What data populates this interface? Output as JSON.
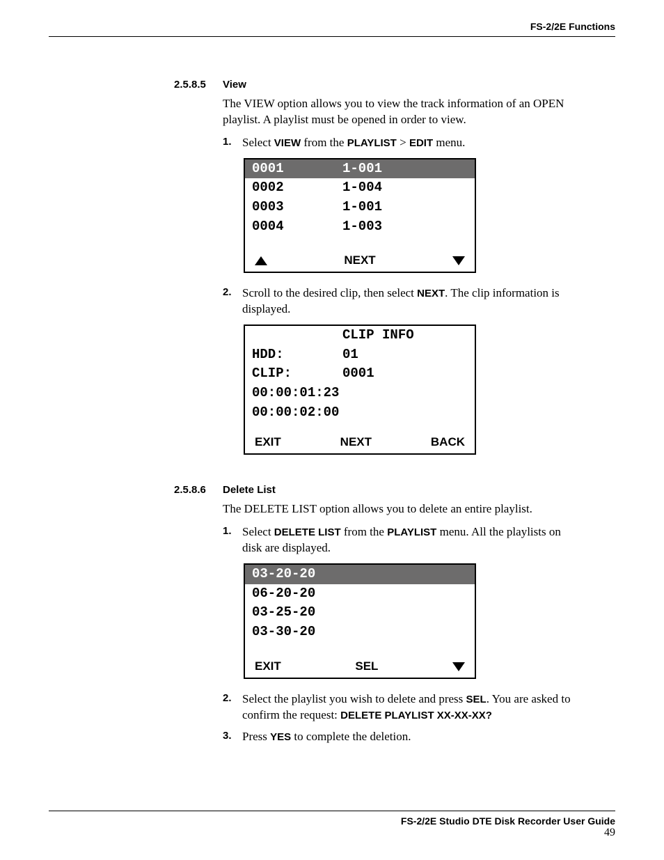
{
  "header": {
    "title": "FS-2/2E Functions"
  },
  "sectionA": {
    "num": "2.5.8.5",
    "title": "View",
    "intro": "The VIEW option allows you to view the track information of an OPEN playlist. A playlist must be opened in order to view.",
    "step1_num": "1.",
    "step1_pre": "Select ",
    "step1_b1": "VIEW",
    "step1_mid": " from the ",
    "step1_b2": "PLAYLIST",
    "step1_gt": " > ",
    "step1_b3": "EDIT",
    "step1_post": " menu.",
    "screen1": {
      "rows": [
        {
          "c1": "0001",
          "c2": "1-001",
          "hl": true
        },
        {
          "c1": "0002",
          "c2": "1-004"
        },
        {
          "c1": "0003",
          "c2": "1-001"
        },
        {
          "c1": "0004",
          "c2": "1-003"
        }
      ],
      "footer_center": "NEXT"
    },
    "step2_num": "2.",
    "step2_pre": "Scroll to the desired clip, then select ",
    "step2_b1": "NEXT",
    "step2_post": ". The clip information is displayed.",
    "screen2": {
      "title": "CLIP INFO",
      "row1_label": "HDD:",
      "row1_val": "01",
      "row2_label": "CLIP:",
      "row2_val": "0001",
      "row3": "00:00:01:23",
      "row4": "00:00:02:00",
      "footer_left": "EXIT",
      "footer_center": "NEXT",
      "footer_right": "BACK"
    }
  },
  "sectionB": {
    "num": "2.5.8.6",
    "title": "Delete List",
    "intro": "The DELETE LIST option allows you to delete an entire playlist.",
    "step1_num": "1.",
    "step1_pre": "Select ",
    "step1_b1": "DELETE LIST",
    "step1_mid": " from the ",
    "step1_b2": "PLAYLIST",
    "step1_post": " menu. All the playlists on disk are displayed.",
    "screen": {
      "rows": [
        {
          "c1": "03-20-20",
          "hl": true
        },
        {
          "c1": "06-20-20"
        },
        {
          "c1": "03-25-20"
        },
        {
          "c1": "03-30-20"
        }
      ],
      "footer_left": "EXIT",
      "footer_center": "SEL"
    },
    "step2_num": "2.",
    "step2_pre": "Select the playlist you wish to delete and press ",
    "step2_b1": "SEL",
    "step2_mid": ". You are asked to confirm the request: ",
    "step2_b2": "DELETE PLAYLIST XX-XX-XX?",
    "step3_num": "3.",
    "step3_pre": "Press ",
    "step3_b1": "YES",
    "step3_post": " to complete the deletion."
  },
  "footer": {
    "title": "FS-2/2E Studio DTE Disk Recorder User Guide",
    "page": "49"
  }
}
